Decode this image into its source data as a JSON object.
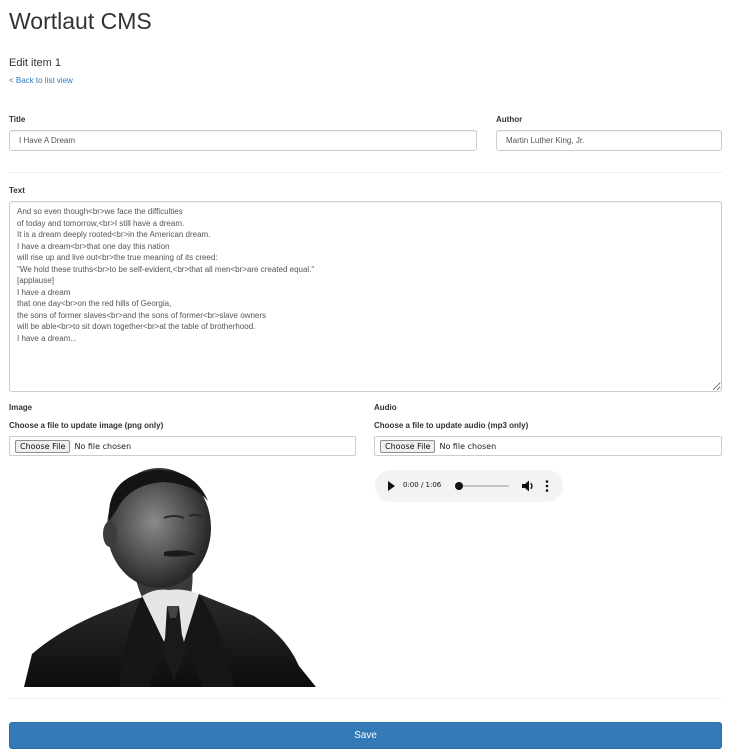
{
  "header": {
    "app_title": "Wortlaut CMS",
    "subtitle": "Edit item 1",
    "back_link": "< Back to list view"
  },
  "form": {
    "title_label": "Title",
    "title_value": "I Have A Dream",
    "author_label": "Author",
    "author_value": "Martin Luther King, Jr.",
    "text_label": "Text",
    "text_value": "And so even though<br>we face the difficulties\nof today and tomorrow,<br>I still have a dream.\nIt is a dream deeply rooted<br>in the American dream.\nI have a dream<br>that one day this nation\nwill rise up and live out<br>the true meaning of its creed:\n\"We hold these truths<br>to be self-evident,<br>that all men<br>are created equal.\"\n[applause]\nI have a dream\nthat one day<br>on the red hills of Georgia,\nthe sons of former slaves<br>and the sons of former<br>slave owners\nwill be able<br>to sit down together<br>at the table of brotherhood.\nI have a dream...",
    "image_label": "Image",
    "image_hint": "Choose a file to update image (png only)",
    "image_button": "Choose File",
    "image_status": "No file chosen",
    "audio_label": "Audio",
    "audio_hint": "Choose a file to update audio (mp3 only)",
    "audio_button": "Choose File",
    "audio_status": "No file chosen",
    "save_label": "Save"
  },
  "audio_player": {
    "time_display": "0:00 / 1:06",
    "progress": 0.0,
    "icons": [
      "play-icon",
      "volume-icon",
      "more-options-icon"
    ]
  },
  "colors": {
    "link": "#337ab7",
    "primary_button": "#337ab7",
    "border": "#cccccc"
  }
}
